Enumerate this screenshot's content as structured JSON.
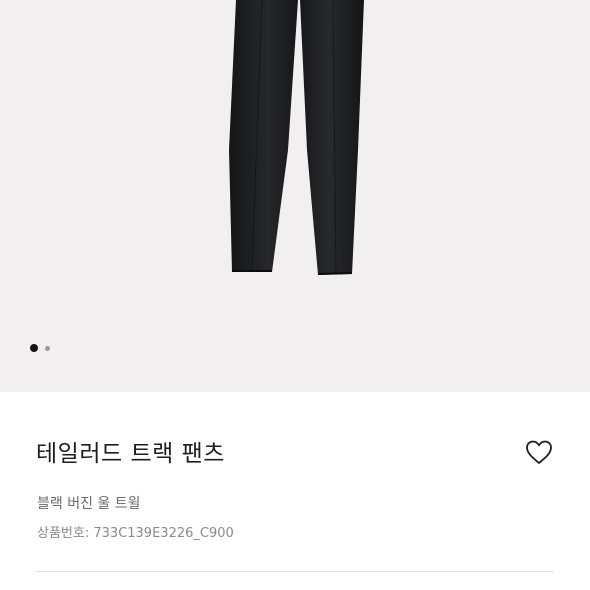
{
  "gallery": {
    "image_alt": "pants-photo",
    "dots": {
      "active": 1,
      "total": 2
    }
  },
  "product": {
    "title": "테일러드 트랙 팬츠",
    "subtitle": "블랙 버진 울 트윌",
    "code_label": "상품번호:",
    "code_value": "733C139E3226_C900",
    "wishlist_icon": "heart-outline-icon"
  },
  "colors": {
    "gallery_bg": "#f2eff0",
    "garment": "#1b1c1e",
    "title_text": "#1e1e1e",
    "subtitle_text": "#6a6a6a"
  }
}
